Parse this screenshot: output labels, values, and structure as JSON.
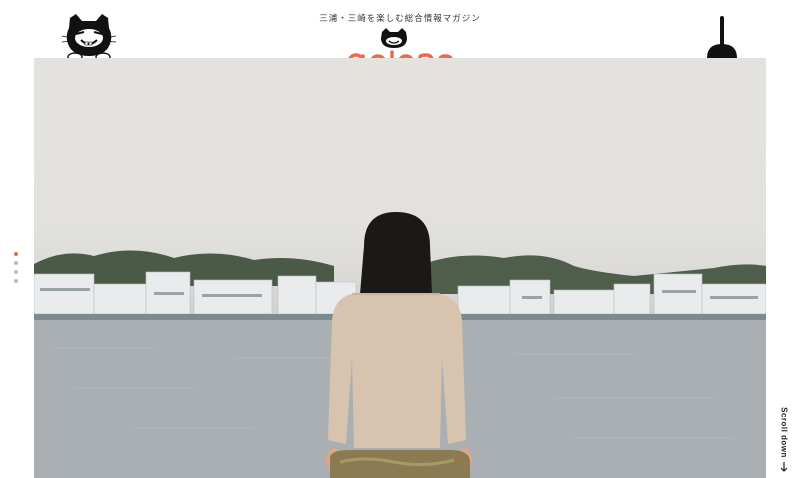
{
  "header": {
    "tagline": "三浦・三崎を楽しむ総合情報マガジン",
    "logo_text": "gorone",
    "mascot_icon": "cat-mascot-icon",
    "menu_icon": "plunger-menu-icon"
  },
  "slider": {
    "dots": 4,
    "active_index": 0
  },
  "scroll": {
    "label": "Scroll down",
    "icon": "arrow-down-icon"
  },
  "colors": {
    "brand": "#e66a50",
    "text": "#222222"
  }
}
